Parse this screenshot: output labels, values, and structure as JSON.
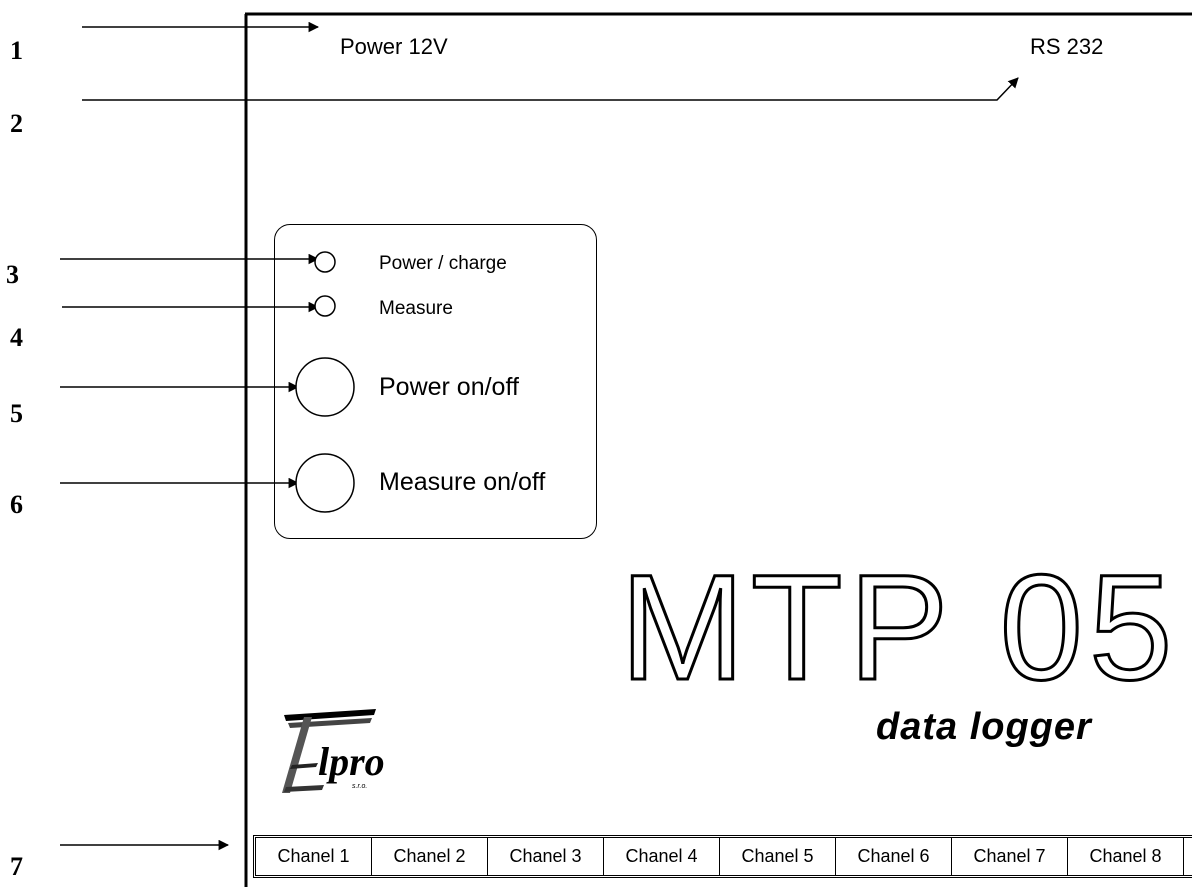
{
  "callouts": [
    "1",
    "2",
    "3",
    "4",
    "5",
    "6",
    "7"
  ],
  "ports": {
    "power": "Power 12V",
    "serial": "RS 232"
  },
  "panel": {
    "led_power": "Power / charge",
    "led_measure": "Measure",
    "btn_power": "Power on/off",
    "btn_measure": "Measure on/off"
  },
  "device": {
    "model": "MTP 05",
    "subtitle": "data logger"
  },
  "logo": {
    "name": "Elpro",
    "word": "lpro",
    "suffix": "s.r.o."
  },
  "channels": [
    "Chanel 1",
    "Chanel 2",
    "Chanel 3",
    "Chanel 4",
    "Chanel 5",
    "Chanel 6",
    "Chanel 7",
    "Chanel 8"
  ]
}
